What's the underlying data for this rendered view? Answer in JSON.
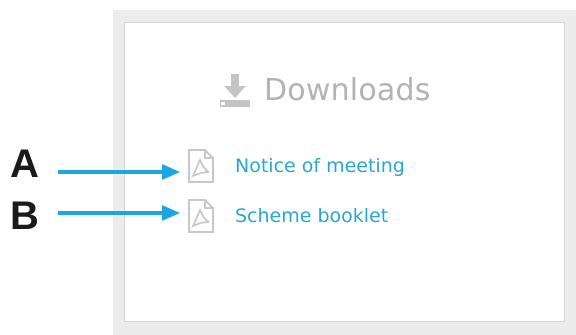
{
  "panel": {
    "title": "Downloads",
    "title_icon": "download-icon"
  },
  "downloads": [
    {
      "label": "Notice of meeting",
      "icon": "pdf-file-icon"
    },
    {
      "label": "Scheme booklet",
      "icon": "pdf-file-icon"
    }
  ],
  "annotations": [
    {
      "marker": "A",
      "target": "Notice of meeting"
    },
    {
      "marker": "B",
      "target": "Scheme booklet"
    }
  ],
  "colors": {
    "link": "#2aa7cf",
    "heading": "#b3b3b3",
    "arrow": "#1aa6e6",
    "icon": "#c7c7c7"
  }
}
